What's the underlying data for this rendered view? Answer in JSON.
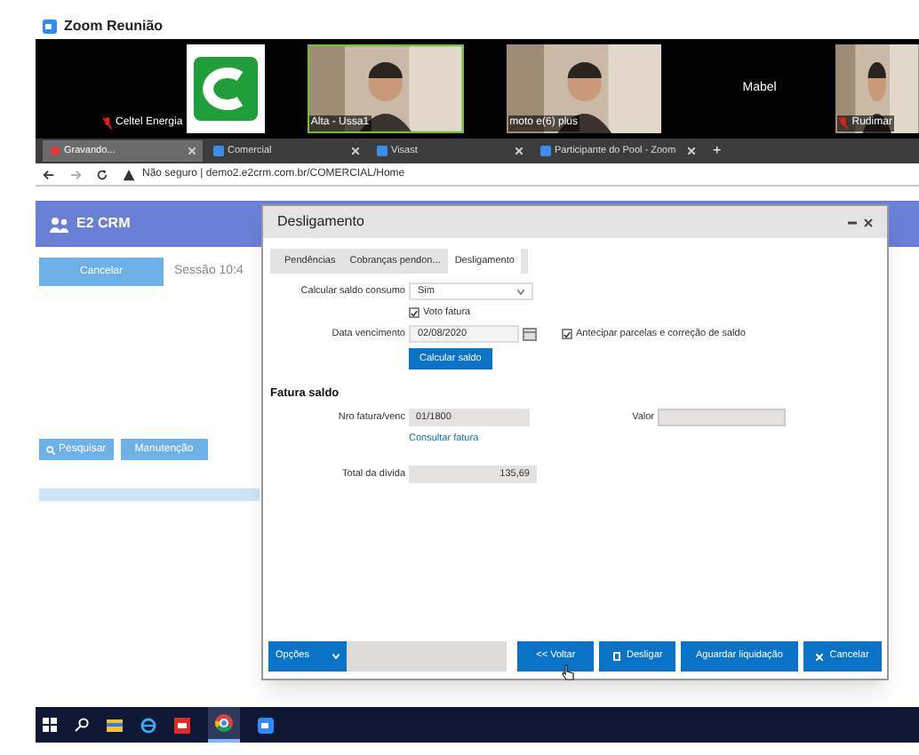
{
  "window": {
    "title": "Zoom Reunião"
  },
  "participants": [
    {
      "kind": "logo",
      "name": "Celtel Energia",
      "muted": true
    },
    {
      "kind": "video",
      "name": "Alta - Ussa1",
      "muted": false,
      "speaking": true
    },
    {
      "kind": "video",
      "name": "moto e(6) plus",
      "muted": false,
      "speaking": false
    },
    {
      "kind": "name",
      "name": "Mabel",
      "muted": false
    },
    {
      "kind": "video",
      "name": "Rudimar",
      "muted": true,
      "speaking": false
    }
  ],
  "browser": {
    "tabs": [
      {
        "label": "Gravando...",
        "selected": true,
        "recording": true
      },
      {
        "label": "Comercial",
        "selected": false
      },
      {
        "label": "Visast",
        "selected": false
      },
      {
        "label": "Participante do Pool - Zoom",
        "selected": false
      }
    ],
    "new_tab": "+",
    "address": "Não seguro | demo2.e2crm.com.br/COMERCIAL/Home"
  },
  "app": {
    "brand": "E2 CRM",
    "cancel_button": "Cancelar",
    "session": "Sessão 10:4",
    "search_button": "Pesquisar",
    "maintenance_button": "Manutenção"
  },
  "dialog": {
    "title": "Desligamento",
    "tabs": [
      {
        "label": "Pendências",
        "selected": false
      },
      {
        "label": "Cobranças pendon...",
        "selected": false
      },
      {
        "label": "Desligamento",
        "selected": true
      }
    ],
    "calc_label": "Calcular saldo consumo",
    "calc_value": "Sim",
    "invoice_check": {
      "label": "Voto fatura",
      "checked": true
    },
    "due_label": "Data vencimento",
    "due_value": "02/08/2020",
    "advance_check": {
      "label": "Antecipar parcelas e correção de saldo",
      "checked": true
    },
    "calc_button": "Calcular saldo",
    "section": "Fatura saldo",
    "invoice_label": "Nro fatura/venc",
    "invoice_value": "01/1800",
    "value_label": "Valor",
    "consult_link": "Consultar fatura",
    "total_label": "Total da dívida",
    "total_value": "135,69",
    "footer": {
      "options": "Opções",
      "back": "<< Voltar",
      "shutdown": "Desligar",
      "wait": "Aguardar liquidação",
      "cancel": "Cancelar"
    }
  }
}
